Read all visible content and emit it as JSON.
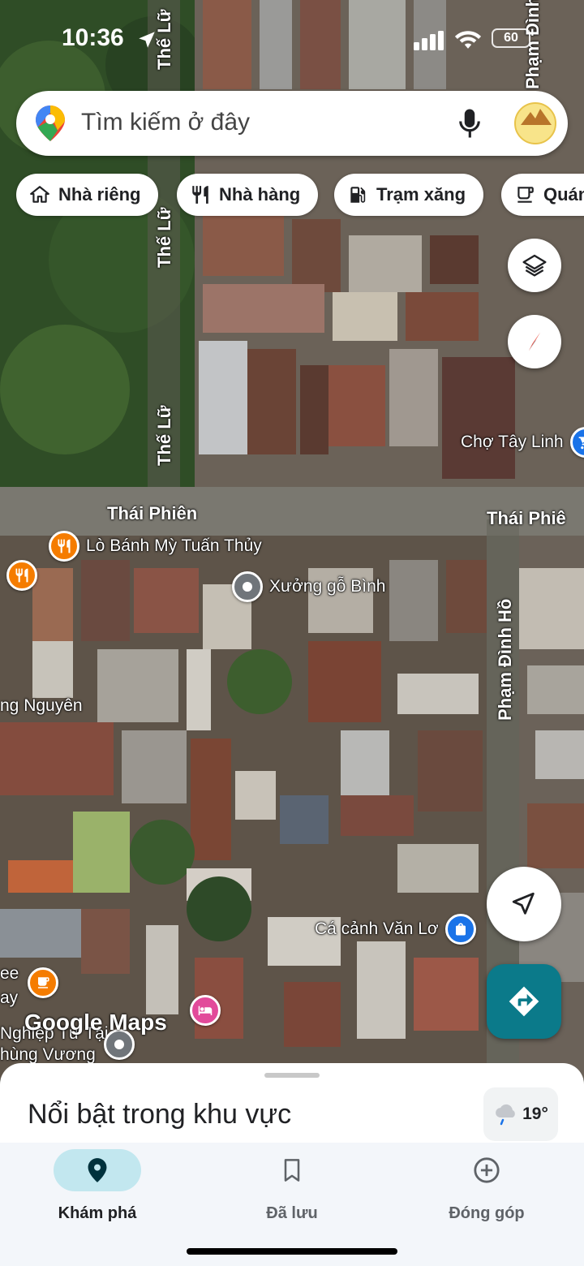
{
  "status_bar": {
    "time": "10:36",
    "battery": "60"
  },
  "search": {
    "placeholder": "Tìm kiếm ở đây"
  },
  "chips": [
    {
      "label": "Nhà riêng",
      "icon": "home-icon"
    },
    {
      "label": "Nhà hàng",
      "icon": "restaurant-icon"
    },
    {
      "label": "Trạm xăng",
      "icon": "gas-station-icon"
    },
    {
      "label": "Quán",
      "icon": "coffee-icon"
    }
  ],
  "map": {
    "streets": {
      "the_lu": "Thế Lữ",
      "thai_phien": "Thái Phiên",
      "thai_phien_right": "Thái Phiê",
      "pham_dinh_ho": "Phạm Đình Hồ",
      "pham_dinh_ho_top": "Phạm Đình Hồ",
      "nguyen_left": "ng Nguyên"
    },
    "pois": {
      "cho_tay_linh": "Chợ Tây Linh",
      "lo_banh_my": "Lò Bánh Mỳ Tuấn Thủy",
      "xuong_go": "Xưởng gỗ Bình",
      "ca_canh": "Cá cảnh Văn Lơ",
      "bottom_left_1": "ee",
      "bottom_left_2": "ay",
      "bottom_left_3": "Nghiệp Tư Tại",
      "bottom_left_4": "hùng Vương"
    },
    "logo": "Google Maps",
    "colors": {
      "shopping": "#1a73e8",
      "food": "#f57c00",
      "hotel": "#e24a9a",
      "generic": "#70757a"
    }
  },
  "sheet": {
    "title": "Nổi bật trong khu vực",
    "temperature": "19°"
  },
  "nav": [
    {
      "label": "Khám phá",
      "icon": "explore-pin-icon",
      "active": true
    },
    {
      "label": "Đã lưu",
      "icon": "bookmark-icon",
      "active": false
    },
    {
      "label": "Đóng góp",
      "icon": "add-circle-icon",
      "active": false
    }
  ],
  "colors": {
    "directions_button": "#0b7a8a",
    "active_nav": "#c2e7ef"
  }
}
